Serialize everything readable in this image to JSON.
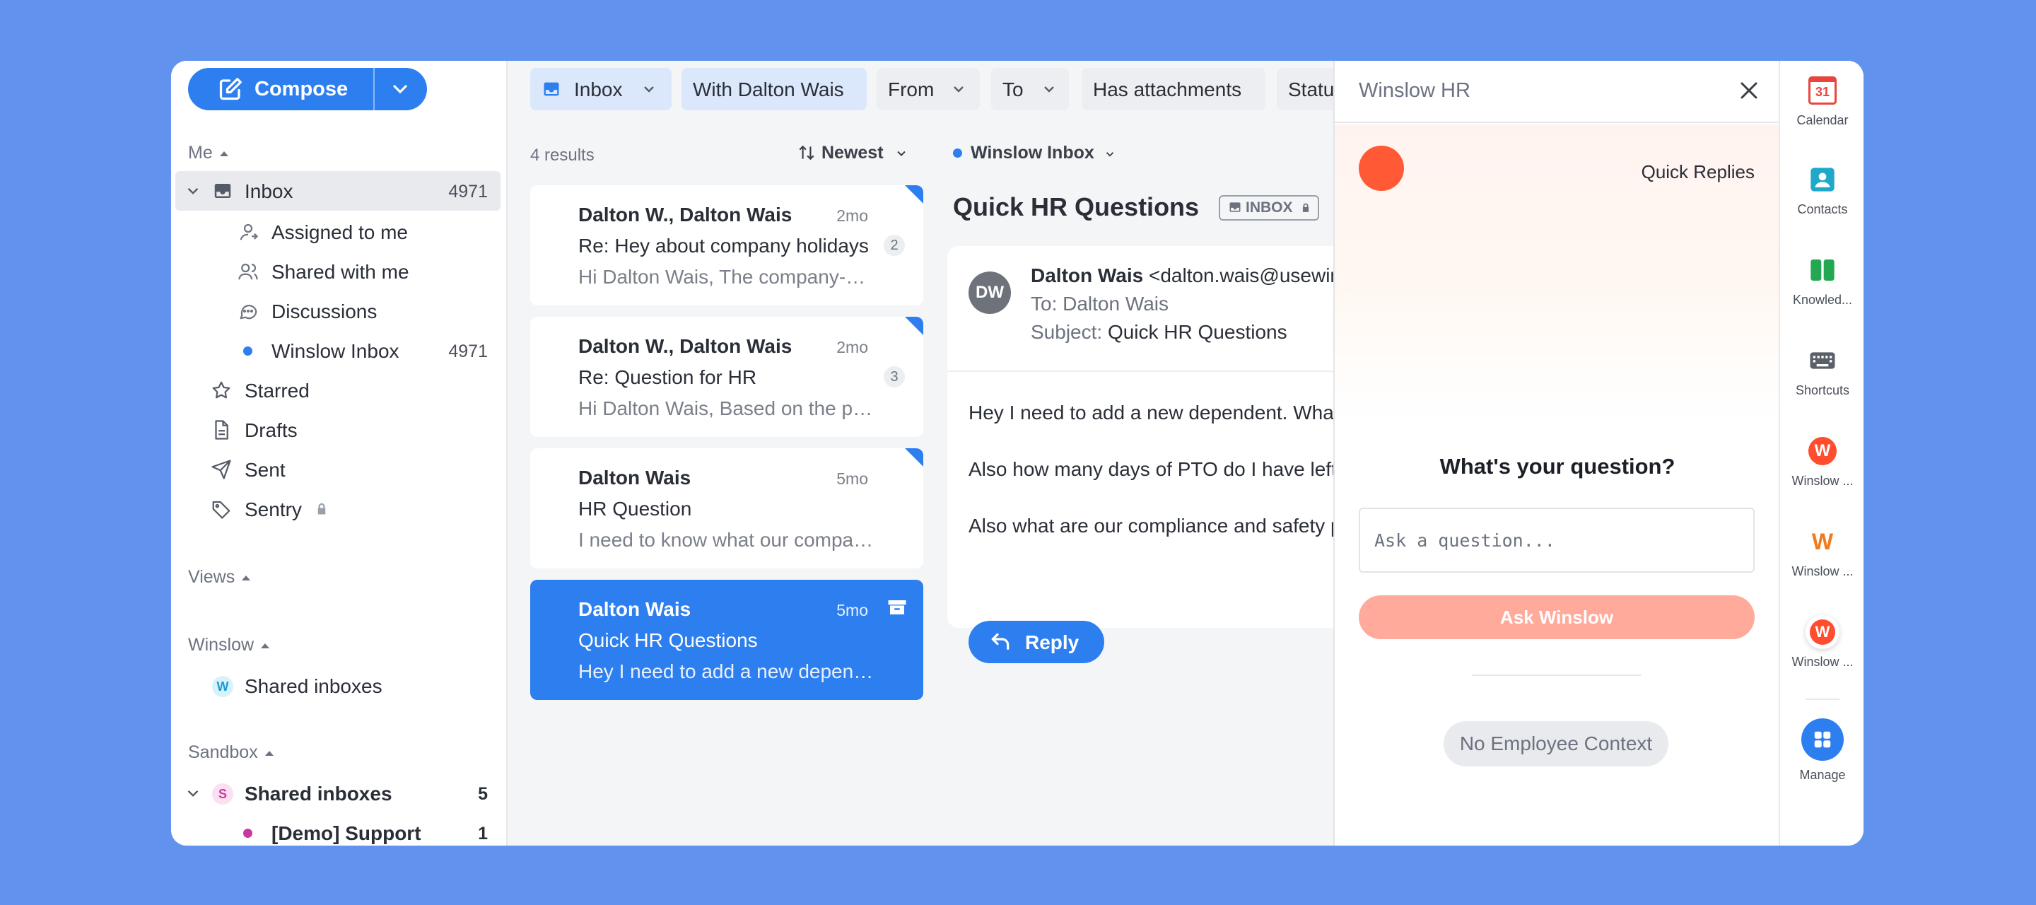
{
  "compose": {
    "label": "Compose"
  },
  "sidebar": {
    "me_header": "Me",
    "inbox": {
      "label": "Inbox",
      "count": "4971"
    },
    "assigned": "Assigned to me",
    "shared_with_me": "Shared with me",
    "discussions": "Discussions",
    "winslow_inbox": {
      "label": "Winslow Inbox",
      "count": "4971"
    },
    "starred": "Starred",
    "drafts": "Drafts",
    "sent": "Sent",
    "sentry": "Sentry",
    "views_header": "Views",
    "winslow_header": "Winslow",
    "winslow_shared": {
      "avatar": "W",
      "label": "Shared inboxes"
    },
    "sandbox_header": "Sandbox",
    "sandbox_shared": {
      "avatar": "S",
      "label": "Shared inboxes",
      "count": "5"
    },
    "demo_support": {
      "label": "[Demo] Support",
      "count": "1"
    }
  },
  "filters": {
    "inbox": "Inbox",
    "with": "With Dalton Wais",
    "from": "From",
    "to": "To",
    "attachments": "Has attachments",
    "status": "Status"
  },
  "list": {
    "results": "4 results",
    "sort": "Newest",
    "items": [
      {
        "from": "Dalton W., Dalton Wais",
        "time": "2mo",
        "subject": "Re: Hey about company holidays",
        "preview": "Hi Dalton Wais, The company-wide holiday",
        "count": "2"
      },
      {
        "from": "Dalton W., Dalton Wais",
        "time": "2mo",
        "subject": "Re: Question for HR",
        "preview": "Hi Dalton Wais, Based on the policy",
        "count": "3"
      },
      {
        "from": "Dalton Wais",
        "time": "5mo",
        "subject": "HR Question",
        "preview": "I need to know what our company policy",
        "count": ""
      },
      {
        "from": "Dalton Wais",
        "time": "5mo",
        "subject": "Quick HR Questions",
        "preview": "Hey I need to add a new dependent.",
        "count": ""
      }
    ]
  },
  "message": {
    "inbox_label": "Winslow Inbox",
    "title": "Quick HR Questions",
    "tag": "INBOX",
    "avatar": "DW",
    "from_name": "Dalton Wais",
    "from_email": "<dalton.wais@usewinslow.com>",
    "to": "To: Dalton Wais",
    "subject_label": "Subject:",
    "subject": "Quick HR Questions",
    "body": [
      "Hey I need to add a new dependent.  What do I need to do?",
      "Also how many days of PTO do I have left?",
      "Also what are our compliance and safety policies?"
    ],
    "reply": "Reply"
  },
  "winslow": {
    "title": "Winslow HR",
    "quick_replies": "Quick Replies",
    "question": "What's your question?",
    "placeholder": "Ask a question...",
    "ask_button": "Ask Winslow",
    "no_context": "No Employee Context"
  },
  "rail": {
    "calendar": "Calendar",
    "calendar_day": "31",
    "contacts": "Contacts",
    "knowledge": "Knowled...",
    "shortcuts": "Shortcuts",
    "winslow1": "Winslow ...",
    "winslow2": "Winslow ...",
    "winslow3": "Winslow ...",
    "manage": "Manage",
    "w_letter": "W"
  },
  "colors": {
    "accent": "#2d7ff0",
    "winslow_orange": "#ff5a35",
    "background": "#6193ee"
  }
}
